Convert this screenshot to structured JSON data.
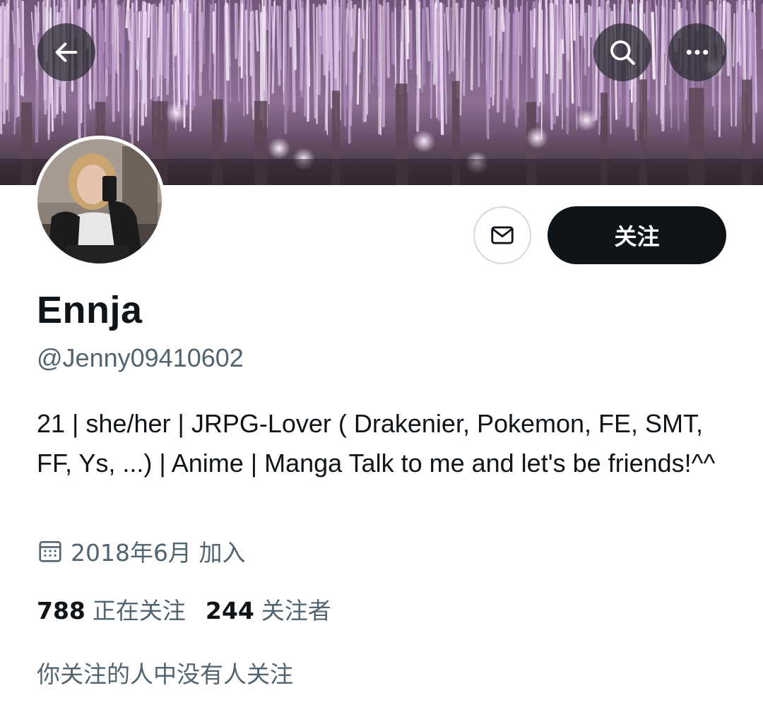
{
  "header": {
    "back_icon": "arrow-left-icon",
    "search_icon": "search-icon",
    "more_icon": "more-horizontal-icon"
  },
  "profile": {
    "display_name": "Ennja",
    "handle": "@Jenny09410602",
    "bio": "21 | she/her | JRPG-Lover ( Drakenier, Pokemon, FE, SMT, FF, Ys, ...) | Anime | Manga Talk to me and let's be friends!^^",
    "joined": "2018年6月 加入",
    "following_count": "788",
    "following_label": "正在关注",
    "followers_count": "244",
    "followers_label": "关注者",
    "followed_by_note": "你关注的人中没有人关注"
  },
  "actions": {
    "follow_label": "关注",
    "message_icon": "mail-icon"
  },
  "colors": {
    "primary_text": "#0f1419",
    "secondary_text": "#536471",
    "follow_button_bg": "#0f1419",
    "button_border": "#cfd9de",
    "banner_tint": "#b79ac8"
  }
}
